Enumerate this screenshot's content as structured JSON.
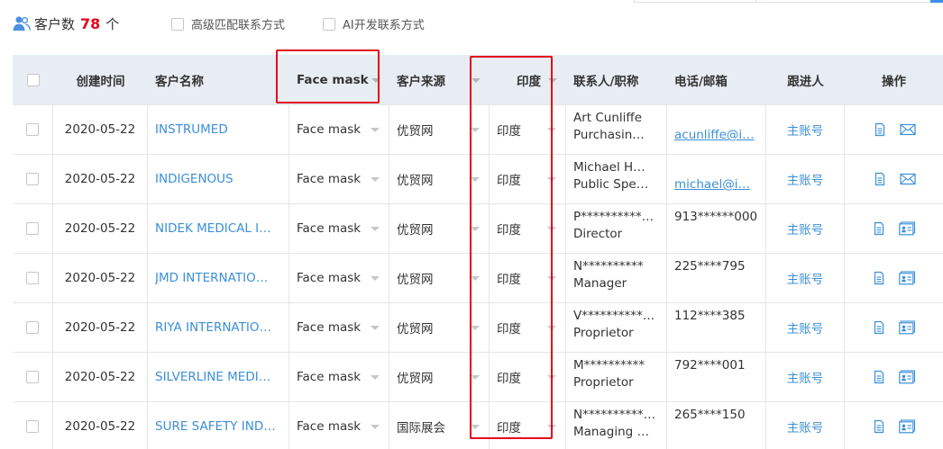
{
  "header": {
    "count_label": "客户数",
    "count_value": "78",
    "count_unit": "个",
    "option_advanced": "高级匹配联系方式",
    "option_ai": "AI开发联系方式"
  },
  "columns": {
    "created": "创建时间",
    "name": "客户名称",
    "product": "Face mask",
    "source": "客户来源",
    "country": "印度",
    "contact": "联系人/职称",
    "phone": "电话/邮箱",
    "owner": "跟进人",
    "ops": "操作"
  },
  "rows": [
    {
      "date": "2020-05-22",
      "name": "INSTRUMED",
      "product": "Face mask",
      "source": "优贸网",
      "country": "印度",
      "contact_name": "Art Cunliffe",
      "contact_title": "Purchasin…",
      "phone": "",
      "email": "acunliffe@i…",
      "owner": "主账号",
      "icon2": "mail-icon"
    },
    {
      "date": "2020-05-22",
      "name": "INDIGENOUS",
      "product": "Face mask",
      "source": "优贸网",
      "country": "印度",
      "contact_name": "Michael H…",
      "contact_title": "Public Spe…",
      "phone": "",
      "email": "michael@i…",
      "owner": "主账号",
      "icon2": "mail-icon"
    },
    {
      "date": "2020-05-22",
      "name": "NIDEK MEDICAL I…",
      "product": "Face mask",
      "source": "优贸网",
      "country": "印度",
      "contact_name": "P**********…",
      "contact_title": "Director",
      "phone": "913******000",
      "email": "",
      "owner": "主账号",
      "icon2": "contact-card-icon"
    },
    {
      "date": "2020-05-22",
      "name": "JMD INTERNATIO…",
      "product": "Face mask",
      "source": "优贸网",
      "country": "印度",
      "contact_name": "N**********",
      "contact_title": "Manager",
      "phone": "225****795",
      "email": "",
      "owner": "主账号",
      "icon2": "contact-card-icon"
    },
    {
      "date": "2020-05-22",
      "name": "RIYA INTERNATIO…",
      "product": "Face mask",
      "source": "优贸网",
      "country": "印度",
      "contact_name": "V**********…",
      "contact_title": "Proprietor",
      "phone": "112****385",
      "email": "",
      "owner": "主账号",
      "icon2": "contact-card-icon"
    },
    {
      "date": "2020-05-22",
      "name": "SILVERLINE MEDI…",
      "product": "Face mask",
      "source": "优贸网",
      "country": "印度",
      "contact_name": "M**********",
      "contact_title": "Proprietor",
      "phone": "792****001",
      "email": "",
      "owner": "主账号",
      "icon2": "contact-card-icon"
    },
    {
      "date": "2020-05-22",
      "name": "SURE SAFETY IND…",
      "product": "Face mask",
      "source": "国际展会",
      "country": "印度",
      "contact_name": "N**********…",
      "contact_title": "Managing …",
      "phone": "265****150",
      "email": "",
      "owner": "主账号",
      "icon2": "contact-card-icon"
    }
  ],
  "colors": {
    "accent": "#3b8fd8",
    "count": "#e3051b",
    "highlight": "#e3051b",
    "header_bg": "#e8edf4"
  }
}
